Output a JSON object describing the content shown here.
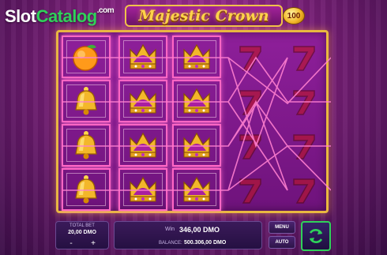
{
  "watermark": {
    "part1": "Slot",
    "part2": "Catalog",
    "part3": ".com"
  },
  "game": {
    "title": "Majestic Crown",
    "badge": "100"
  },
  "reels": [
    [
      "orange",
      "bell",
      "bell",
      "bell"
    ],
    [
      "crown",
      "crown",
      "crown",
      "crown"
    ],
    [
      "crown",
      "crown",
      "crown",
      "crown"
    ],
    [
      "seven",
      "seven",
      "seven",
      "seven"
    ],
    [
      "seven",
      "seven",
      "seven",
      "seven"
    ]
  ],
  "controls": {
    "total_bet_label": "TOTAL BET",
    "total_bet_value": "20,00 DMO",
    "minus": "-",
    "plus": "+",
    "win_label": "Win",
    "win_value": "346,00 DMO",
    "balance_label": "BALANCE:",
    "balance_value": "500.306,00 DMO",
    "menu_label": "MENU",
    "auto_label": "AUTO"
  },
  "colors": {
    "frame": "#e9b840",
    "accent": "#2fd15a",
    "win_line": "#ff66c4"
  },
  "icons": {
    "spin": "refresh-icon"
  }
}
